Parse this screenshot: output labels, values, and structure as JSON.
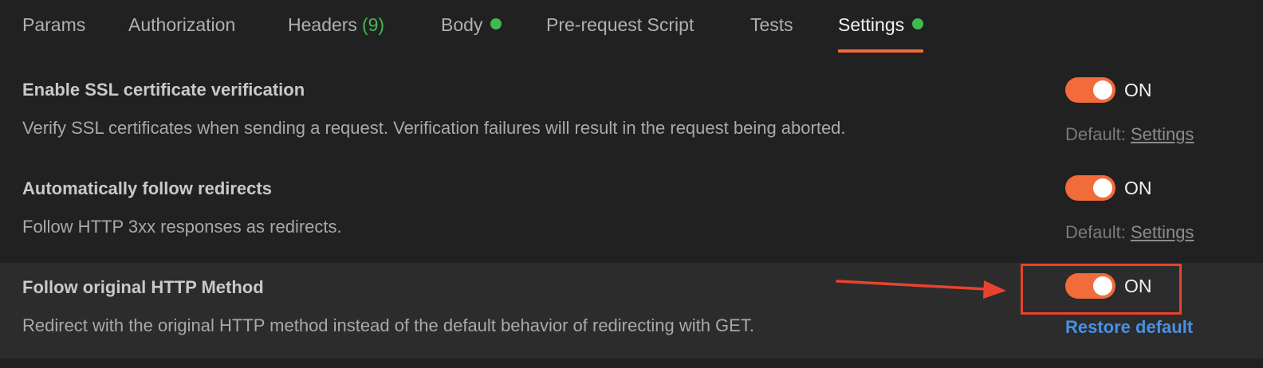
{
  "colors": {
    "accent": "#f26b3a",
    "status_dot": "#3fb950",
    "link_blue": "#4a90e2",
    "annotation_red": "#e8432d"
  },
  "tabs": [
    {
      "label": "Params"
    },
    {
      "label": "Authorization"
    },
    {
      "label": "Headers",
      "count": "(9)"
    },
    {
      "label": "Body",
      "indicator": "green-dot"
    },
    {
      "label": "Pre-request Script"
    },
    {
      "label": "Tests"
    },
    {
      "label": "Settings",
      "indicator": "green-dot",
      "active": true
    }
  ],
  "settings": [
    {
      "title": "Enable SSL certificate verification",
      "description": "Verify SSL certificates when sending a request. Verification failures will result in the request being aborted.",
      "toggle_state": "ON",
      "default_prefix": "Default: ",
      "default_link": "Settings"
    },
    {
      "title": "Automatically follow redirects",
      "description": "Follow HTTP 3xx responses as redirects.",
      "toggle_state": "ON",
      "default_prefix": "Default: ",
      "default_link": "Settings"
    },
    {
      "title": "Follow original HTTP Method",
      "description": "Redirect with the original HTTP method instead of the default behavior of redirecting with GET.",
      "toggle_state": "ON",
      "restore_label": "Restore default"
    }
  ]
}
